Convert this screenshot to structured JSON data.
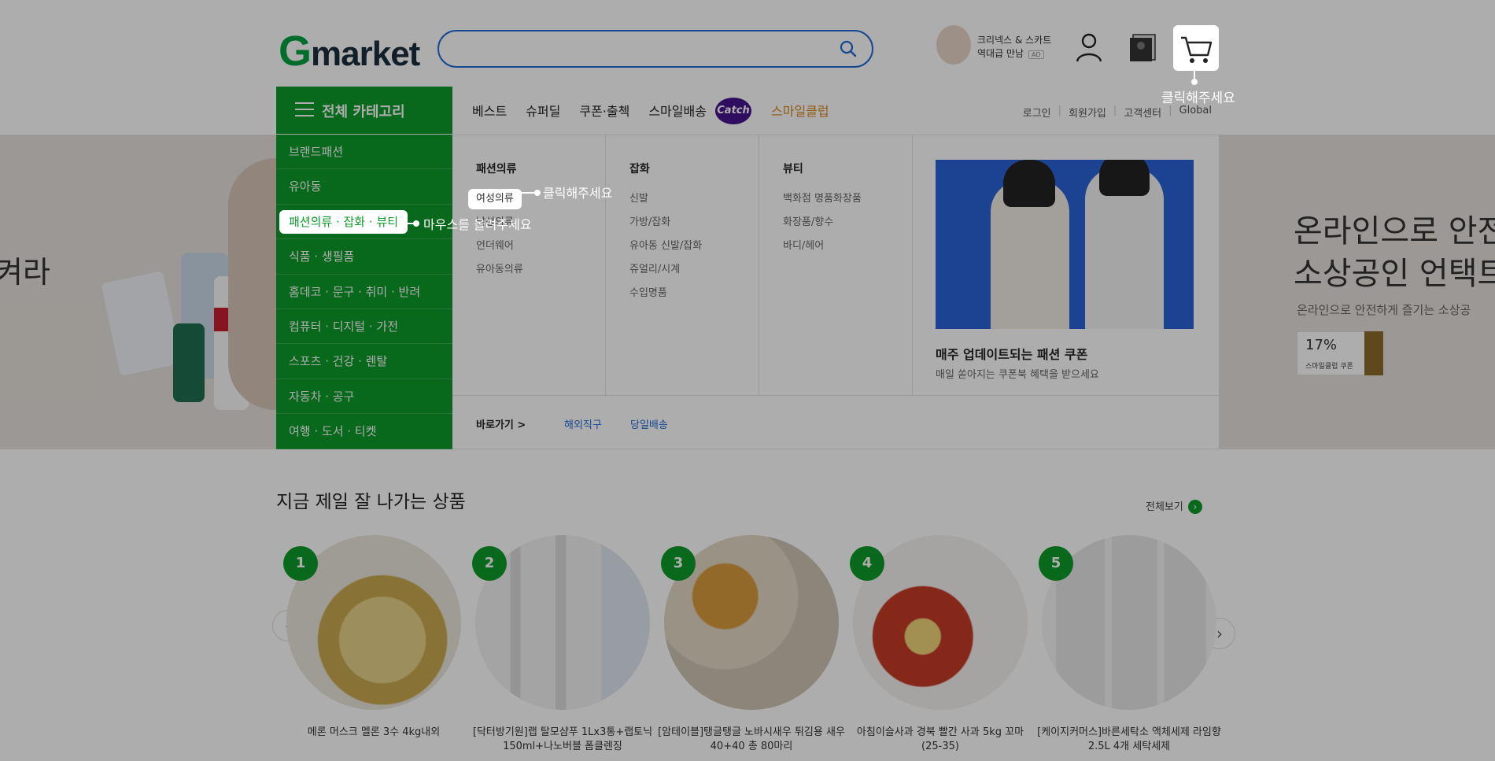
{
  "header": {
    "logo": {
      "g": "G",
      "rest": "market"
    },
    "search": {
      "placeholder": ""
    },
    "promo": {
      "line1": "크리넥스 & 스카트",
      "line2": "역대급 만남",
      "ad": "AD"
    },
    "cart_hint": "클릭해주세요"
  },
  "nav": {
    "category_title": "전체 카테고리",
    "links": [
      "베스트",
      "슈퍼딜",
      "쿠폰·출첵",
      "스마일배송"
    ],
    "catch": "Catch",
    "smile_club": "스마일클럽",
    "util": [
      "로그인",
      "회원가입",
      "고객센터",
      "Global"
    ]
  },
  "categories": [
    "브랜드패션",
    "유아동",
    "패션의류 · 잡화 · 뷰티",
    "식품 · 생필품",
    "홈데코 · 문구 · 취미 · 반려",
    "컴퓨터 · 디지털 · 가전",
    "스포츠 · 건강 · 렌탈",
    "자동차 · 공구",
    "여행 · 도서 · 티켓"
  ],
  "category_hint": "마우스를 올려주세요",
  "mega": {
    "columns": [
      {
        "title": "패션의류",
        "items": [
          "여성의류",
          "남성의류",
          "언더웨어",
          "유아동의류"
        ]
      },
      {
        "title": "잡화",
        "items": [
          "신발",
          "가방/잡화",
          "유아동 신발/잡화",
          "쥬얼리/시계",
          "수입명품"
        ]
      },
      {
        "title": "뷰티",
        "items": [
          "백화점 명품화장품",
          "화장품/향수",
          "바디/헤어"
        ]
      }
    ],
    "item_hint": "클릭해주세요",
    "promo_title": "매주 업데이트되는 패션 쿠폰",
    "promo_desc": "매일 쏟아지는 쿠폰북 혜택을 받으세요",
    "quick_label": "바로가기 >",
    "quick_links": [
      "해외직구",
      "당일배송"
    ]
  },
  "banner": {
    "left_text": "켜라",
    "right_line1": "온라인으로 안전",
    "right_line2": "소상공인 언택트",
    "right_line3": "온라인으로 안전하게 즐기는 소상공",
    "coupon_pct": "17%",
    "coupon_label": "스마일클럽 쿠폰"
  },
  "best": {
    "title": "지금 제일 잘 나가는 상품",
    "view_all": "전체보기",
    "products": [
      {
        "rank": "1",
        "name": "메론 머스크 멜론 3수 4kg내외"
      },
      {
        "rank": "2",
        "name": "[닥터방기원]랩 탈모샴푸 1Lx3통+랩토닉 150ml+나노버블 폼클렌징"
      },
      {
        "rank": "3",
        "name": "[암테이블]탱글탱글 노바시새우 튀김용 새우 40+40 총 80마리"
      },
      {
        "rank": "4",
        "name": "아침이슬사과 경북 빨간 사과 5kg 꼬마(25-35)"
      },
      {
        "rank": "5",
        "name": "[케이지커머스]바른세탁소 액체세제 라임향 2.5L 4개 세탁세제"
      }
    ]
  },
  "colors": {
    "brand_green": "#0d9b2a",
    "search_blue": "#1f6bd8",
    "catch_purple": "#46168d"
  }
}
